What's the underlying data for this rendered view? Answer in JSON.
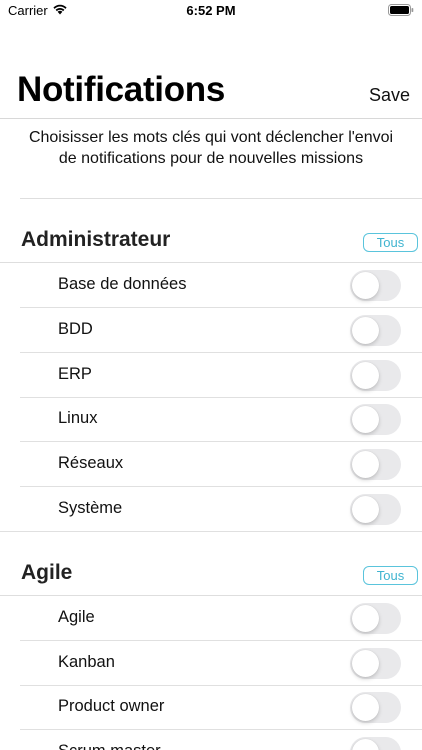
{
  "status_bar": {
    "carrier": "Carrier",
    "time": "6:52 PM",
    "wifi_icon": "wifi-icon",
    "battery_icon": "battery-icon"
  },
  "header": {
    "title": "Notifications",
    "save_label": "Save"
  },
  "intro": {
    "text": "Choisisser les mots clés qui vont déclencher l'envoi de notifications pour de nouvelles missions"
  },
  "accent_color": "#3fb4d0",
  "sections": [
    {
      "title": "Administrateur",
      "tous_label": "Tous",
      "items": [
        {
          "label": "Base de données",
          "enabled": false
        },
        {
          "label": "BDD",
          "enabled": false
        },
        {
          "label": "ERP",
          "enabled": false
        },
        {
          "label": "Linux",
          "enabled": false
        },
        {
          "label": "Réseaux",
          "enabled": false
        },
        {
          "label": "Système",
          "enabled": false
        }
      ]
    },
    {
      "title": "Agile",
      "tous_label": "Tous",
      "items": [
        {
          "label": "Agile",
          "enabled": false
        },
        {
          "label": "Kanban",
          "enabled": false
        },
        {
          "label": "Product owner",
          "enabled": false
        },
        {
          "label": "Scrum master",
          "enabled": false
        }
      ]
    }
  ]
}
